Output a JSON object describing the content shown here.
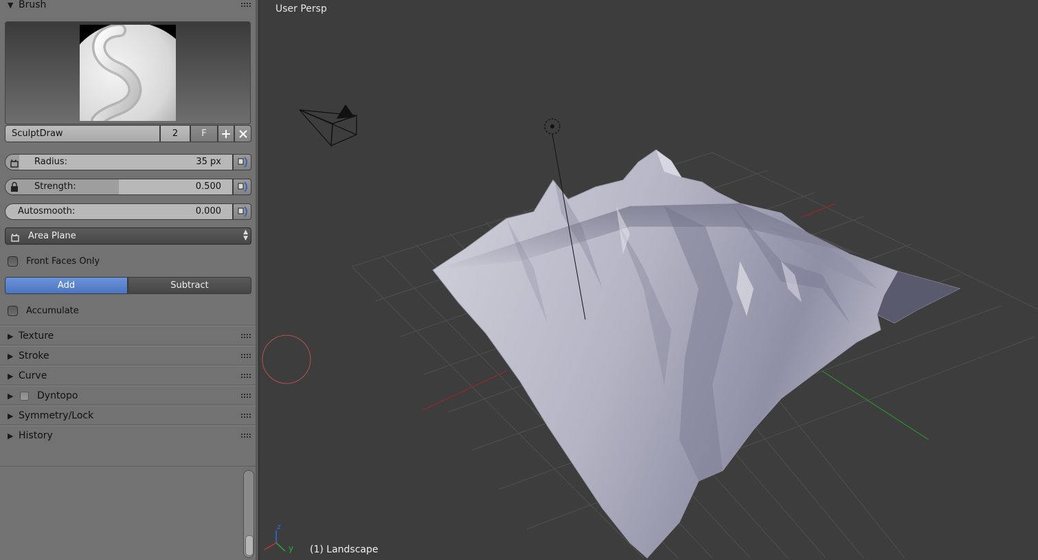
{
  "panel": {
    "brush_header": "Brush",
    "brush": {
      "name": "SculptDraw",
      "users": "2",
      "fake_user": "F"
    },
    "radius": {
      "label": "Radius:",
      "value": "35 px",
      "fraction": 0.06
    },
    "strength": {
      "label": "Strength:",
      "value": "0.500",
      "fraction": 0.5
    },
    "autosmooth": {
      "label": "Autosmooth:",
      "value": "0.000",
      "fraction": 0.0
    },
    "plane_dropdown": "Area Plane",
    "front_faces_only": {
      "label": "Front Faces Only",
      "checked": false
    },
    "mode": {
      "add": "Add",
      "subtract": "Subtract",
      "active": "Add"
    },
    "accumulate": {
      "label": "Accumulate",
      "checked": false
    },
    "subpanels": [
      {
        "label": "Texture"
      },
      {
        "label": "Stroke"
      },
      {
        "label": "Curve"
      },
      {
        "label": "Dyntopo",
        "has_checkbox": true
      },
      {
        "label": "Symmetry/Lock"
      },
      {
        "label": "History"
      }
    ]
  },
  "viewport": {
    "view_name": "User Persp",
    "object_label": "(1) Landscape",
    "axis_labels": {
      "z": "z",
      "y": "y"
    }
  },
  "colors": {
    "panel_bg": "#727272",
    "viewport_bg": "#3d3d3d",
    "active_button": "#5680cc",
    "x_axis": "#9a2b2b",
    "y_axis": "#2e8a2e",
    "brush_circle": "#b5524f",
    "terrain": "#a9a9b9"
  }
}
